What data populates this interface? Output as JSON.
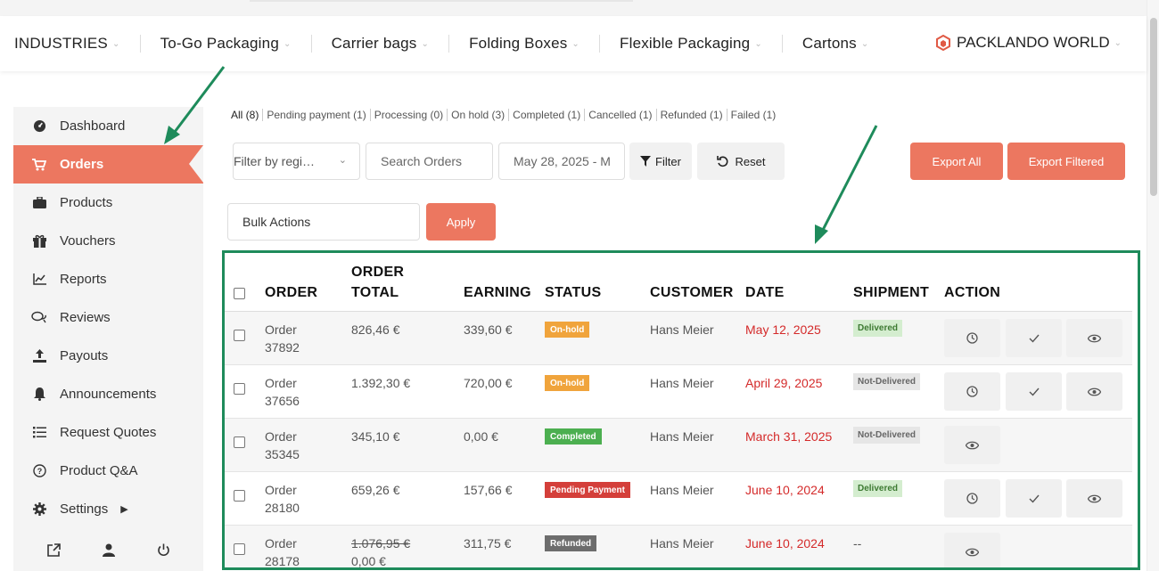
{
  "topnav": {
    "items": [
      {
        "label": "INDUSTRIES"
      },
      {
        "label": "To-Go Packaging"
      },
      {
        "label": "Carrier bags"
      },
      {
        "label": "Folding Boxes"
      },
      {
        "label": "Flexible Packaging"
      },
      {
        "label": "Cartons"
      }
    ],
    "brand": "PACKLANDO WORLD"
  },
  "sidebar": {
    "items": [
      {
        "label": "Dashboard",
        "icon": "dashboard-gauge-icon"
      },
      {
        "label": "Orders",
        "icon": "cart-icon",
        "active": true
      },
      {
        "label": "Products",
        "icon": "briefcase-icon"
      },
      {
        "label": "Vouchers",
        "icon": "gift-icon"
      },
      {
        "label": "Reports",
        "icon": "line-chart-icon"
      },
      {
        "label": "Reviews",
        "icon": "comments-icon"
      },
      {
        "label": "Payouts",
        "icon": "upload-icon"
      },
      {
        "label": "Announcements",
        "icon": "bell-icon"
      },
      {
        "label": "Request Quotes",
        "icon": "list-icon"
      },
      {
        "label": "Product Q&A",
        "icon": "question-circle-icon"
      },
      {
        "label": "Settings",
        "icon": "gear-icon"
      }
    ]
  },
  "filters": [
    {
      "label": "All (8)"
    },
    {
      "label": "Pending payment (1)"
    },
    {
      "label": "Processing (0)"
    },
    {
      "label": "On hold (3)"
    },
    {
      "label": "Completed (1)"
    },
    {
      "label": "Cancelled (1)"
    },
    {
      "label": "Refunded (1)"
    },
    {
      "label": "Failed (1)"
    }
  ],
  "controls": {
    "region_value": "Filter by regi…",
    "search_placeholder": "Search Orders",
    "date_value": "May 28, 2025 - M",
    "filter_label": "Filter",
    "reset_label": "Reset",
    "export_all": "Export All",
    "export_filtered": "Export Filtered",
    "bulk_actions": "Bulk Actions",
    "apply": "Apply"
  },
  "table": {
    "headers": {
      "order": "ORDER",
      "order_total_1": "ORDER",
      "order_total_2": "TOTAL",
      "earning": "EARNING",
      "status": "STATUS",
      "customer": "CUSTOMER",
      "date": "DATE",
      "shipment": "SHIPMENT",
      "action": "ACTION"
    },
    "rows": [
      {
        "order_1": "Order",
        "order_2": "37892",
        "total": "826,46 €",
        "earning": "339,60 €",
        "status": "On-hold",
        "customer": "Hans Meier",
        "date": "May 12, 2025",
        "shipment": "Delivered"
      },
      {
        "order_1": "Order",
        "order_2": "37656",
        "total": "1.392,30 €",
        "earning": "720,00 €",
        "status": "On-hold",
        "customer": "Hans Meier",
        "date": "April 29, 2025",
        "shipment": "Not-Delivered"
      },
      {
        "order_1": "Order",
        "order_2": "35345",
        "total": "345,10 €",
        "earning": "0,00 €",
        "status": "Completed",
        "customer": "Hans Meier",
        "date": "March 31, 2025",
        "shipment": "Not-Delivered"
      },
      {
        "order_1": "Order",
        "order_2": "28180",
        "total": "659,26 €",
        "earning": "157,66 €",
        "status": "Pending Payment",
        "customer": "Hans Meier",
        "date": "June 10, 2024",
        "shipment": "Delivered"
      },
      {
        "order_1": "Order",
        "order_2": "28178",
        "total": "1.076,95 €",
        "total_new": "0,00 €",
        "earning": "311,75 €",
        "status": "Refunded",
        "customer": "Hans Meier",
        "date": "June 10, 2024",
        "shipment": "--"
      }
    ]
  },
  "colors": {
    "accent": "#ec7760",
    "highlight": "#1e8b5b",
    "date_red": "#d42a2a",
    "on_hold": "#f0a43c",
    "completed": "#4caf50",
    "pending": "#d43f3a",
    "refunded": "#6d6d6d"
  }
}
